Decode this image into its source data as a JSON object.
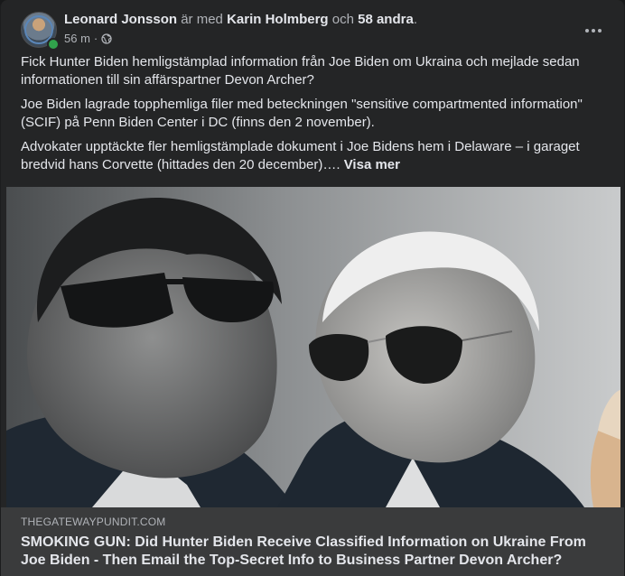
{
  "post": {
    "author": "Leonard Jonsson",
    "with_text": "är med",
    "tagged_person": "Karin Holmberg",
    "and_text": "och",
    "others": "58 andra",
    "period": ".",
    "timestamp": "56 m",
    "separator": "·",
    "audience_icon": "globe-icon",
    "more_icon": "more-options-icon",
    "paragraphs": [
      "Fick Hunter Biden hemligstämplad information från Joe Biden om Ukraina och mejlade sedan informationen till sin affärspartner Devon Archer?",
      "Joe Biden lagrade topphemliga filer med beteckningen \"sensitive compartmented information\" (SCIF) på Penn Biden Center i DC (finns den 2 november).",
      "Advokater upptäckte fler hemligstämplade dokument i Joe Bidens hem i Delaware – i garaget bredvid hans Corvette (hittades den 20 december)…."
    ],
    "see_more": "Visa mer"
  },
  "link": {
    "domain": "THEGATEWAYPUNDIT.COM",
    "title": "SMOKING GUN: Did Hunter Biden Receive Classified Information on Ukraine From Joe Biden - Then Email the Top-Secret Info to Business Partner Devon Archer?"
  },
  "colors": {
    "background": "#18191a",
    "card": "#242526",
    "link_footer": "#3a3b3c",
    "primary_text": "#e4e6eb",
    "secondary_text": "#b0b3b8",
    "online": "#31a24c"
  }
}
